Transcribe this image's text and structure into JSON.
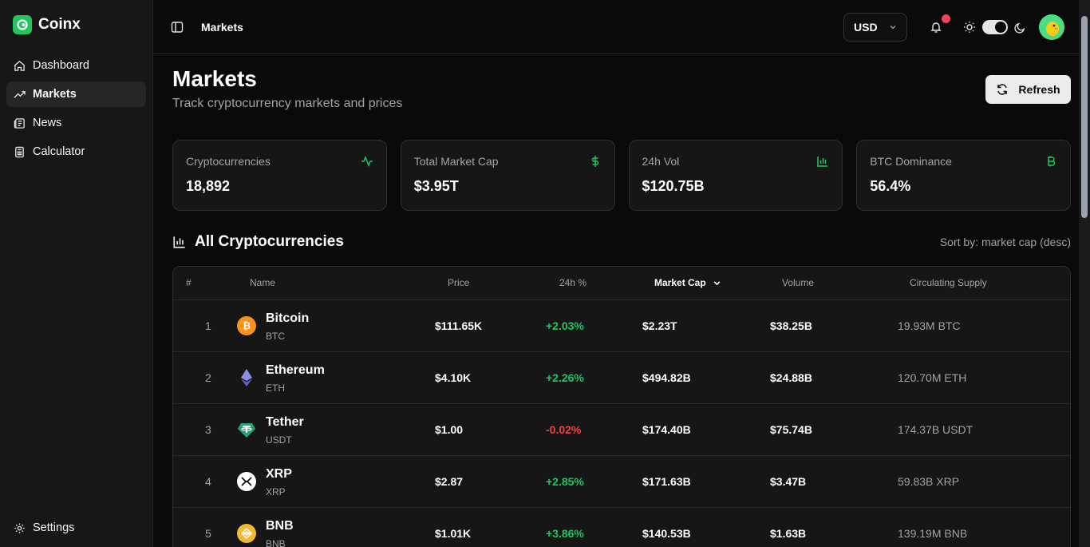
{
  "app": {
    "name": "Coinx"
  },
  "sidebar": {
    "items": [
      {
        "label": "Dashboard",
        "icon": "home-icon"
      },
      {
        "label": "Markets",
        "icon": "trending-up-icon"
      },
      {
        "label": "News",
        "icon": "newspaper-icon"
      },
      {
        "label": "Calculator",
        "icon": "calculator-icon"
      }
    ],
    "settings_label": "Settings"
  },
  "topbar": {
    "breadcrumb": "Markets",
    "currency": "USD"
  },
  "page": {
    "title": "Markets",
    "subtitle": "Track cryptocurrency markets and prices",
    "refresh_label": "Refresh"
  },
  "stats": [
    {
      "label": "Cryptocurrencies",
      "value": "18,892",
      "icon": "activity-icon"
    },
    {
      "label": "Total Market Cap",
      "value": "$3.95T",
      "icon": "dollar-icon"
    },
    {
      "label": "24h Vol",
      "value": "$120.75B",
      "icon": "bar-chart-icon"
    },
    {
      "label": "BTC Dominance",
      "value": "56.4%",
      "icon": "bitcoin-icon"
    }
  ],
  "section": {
    "title": "All Cryptocurrencies",
    "sort_text": "Sort by: market cap (desc)"
  },
  "table": {
    "headers": {
      "rank": "#",
      "name": "Name",
      "price": "Price",
      "change": "24h %",
      "market_cap": "Market Cap",
      "volume": "Volume",
      "supply": "Circulating Supply"
    },
    "rows": [
      {
        "rank": "1",
        "name": "Bitcoin",
        "symbol": "BTC",
        "price": "$111.65K",
        "change": "+2.03%",
        "market_cap": "$2.23T",
        "volume": "$38.25B",
        "supply": "19.93M BTC"
      },
      {
        "rank": "2",
        "name": "Ethereum",
        "symbol": "ETH",
        "price": "$4.10K",
        "change": "+2.26%",
        "market_cap": "$494.82B",
        "volume": "$24.88B",
        "supply": "120.70M ETH"
      },
      {
        "rank": "3",
        "name": "Tether",
        "symbol": "USDT",
        "price": "$1.00",
        "change": "-0.02%",
        "market_cap": "$174.40B",
        "volume": "$75.74B",
        "supply": "174.37B USDT"
      },
      {
        "rank": "4",
        "name": "XRP",
        "symbol": "XRP",
        "price": "$2.87",
        "change": "+2.85%",
        "market_cap": "$171.63B",
        "volume": "$3.47B",
        "supply": "59.83B XRP"
      },
      {
        "rank": "5",
        "name": "BNB",
        "symbol": "BNB",
        "price": "$1.01K",
        "change": "+3.86%",
        "market_cap": "$140.53B",
        "volume": "$1.63B",
        "supply": "139.19M BNB"
      }
    ]
  },
  "colors": {
    "accent": "#22c55e",
    "negative": "#ef4444",
    "background": "#0a0a0a"
  }
}
